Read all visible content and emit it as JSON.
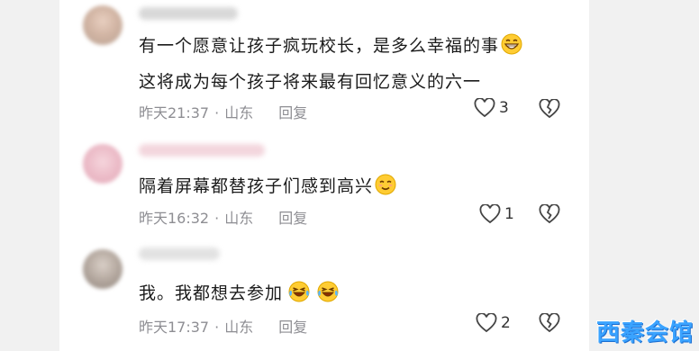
{
  "comments": [
    {
      "lines": [
        "有一个愿意让孩子疯玩校长，是多么幸福的事",
        "这将成为每个孩子将来最有回忆意义的六一"
      ],
      "time": "昨天21:37",
      "location": "山东",
      "reply_label": "回复",
      "likes": "3"
    },
    {
      "lines": [
        "隔着屏幕都替孩子们感到高兴"
      ],
      "time": "昨天16:32",
      "location": "山东",
      "reply_label": "回复",
      "likes": "1"
    },
    {
      "lines": [
        "我。我都想去参加"
      ],
      "time": "昨天17:37",
      "location": "山东",
      "reply_label": "回复",
      "likes": "2"
    }
  ],
  "separator": "·",
  "watermark": "西秦会馆",
  "colors": {
    "meta_gray": "#8e8e93",
    "text": "#1b1b1b",
    "watermark_blue": "#3aa3ff"
  },
  "icons": {
    "like": "heart-outline-icon",
    "dislike": "broken-heart-outline-icon",
    "emoji_grin": "grinning-emoji-icon",
    "emoji_smile": "smiling-emoji-icon",
    "emoji_laugh_cry": "laughing-crying-emoji-icon"
  }
}
